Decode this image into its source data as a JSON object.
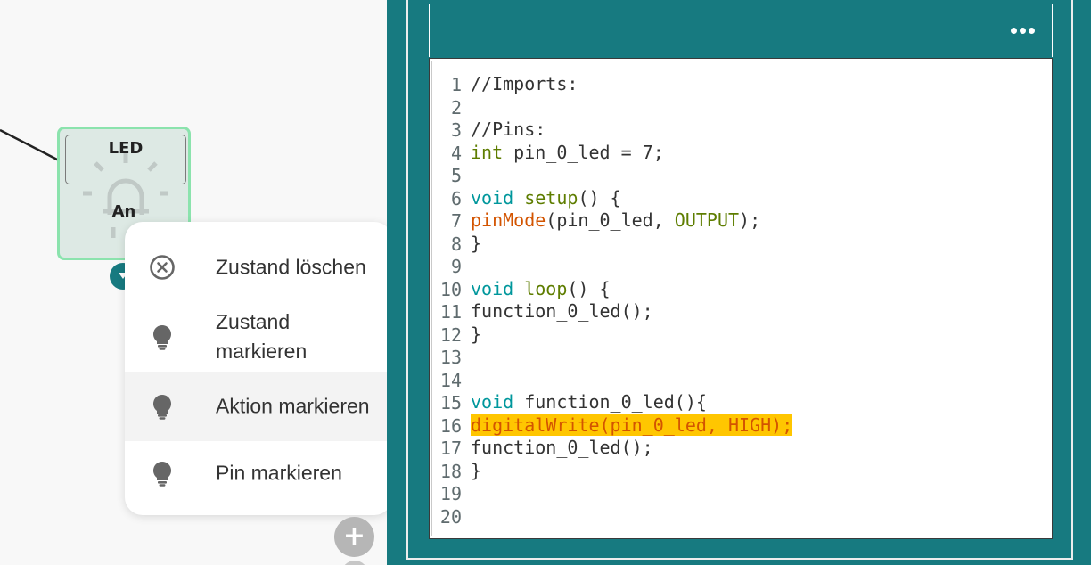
{
  "canvas": {
    "state_node": {
      "title": "LED",
      "value": "An",
      "icon": "lightbulb-icon"
    },
    "context_menu": {
      "items": [
        {
          "label": "Zustand löschen",
          "icon": "close-circle-icon"
        },
        {
          "label": "Zustand markieren",
          "icon": "lightbulb-icon"
        },
        {
          "label": "Aktion markieren",
          "icon": "lightbulb-icon",
          "hovered": true
        },
        {
          "label": "Pin markieren",
          "icon": "lightbulb-icon"
        }
      ]
    },
    "add_button": {
      "label": "+",
      "icon": "plus-icon"
    }
  },
  "editor": {
    "menu_icon": "more-horizontal-icon",
    "colors": {
      "frame": "#177a80",
      "keyword": "#00979c",
      "function": "#5e7d00",
      "call": "#d35400",
      "highlight": "#ffc600"
    },
    "line_numbers": [
      "1",
      "2",
      "3",
      "4",
      "5",
      "6",
      "7",
      "8",
      "9",
      "10",
      "11",
      "12",
      "13",
      "14",
      "15",
      "16",
      "17",
      "18",
      "19",
      "20"
    ],
    "lines": [
      {
        "num": "1",
        "tokens": [
          {
            "t": "//Imports:",
            "c": ""
          }
        ]
      },
      {
        "num": "2",
        "tokens": []
      },
      {
        "num": "3",
        "tokens": [
          {
            "t": "//Pins:",
            "c": ""
          }
        ]
      },
      {
        "num": "4",
        "tokens": [
          {
            "t": "int",
            "c": "fn"
          },
          {
            "t": " pin_0_led = 7;",
            "c": ""
          }
        ]
      },
      {
        "num": "5",
        "tokens": []
      },
      {
        "num": "6",
        "tokens": [
          {
            "t": "void",
            "c": "kw"
          },
          {
            "t": " ",
            "c": ""
          },
          {
            "t": "setup",
            "c": "fn"
          },
          {
            "t": "() {",
            "c": ""
          }
        ]
      },
      {
        "num": "7",
        "tokens": [
          {
            "t": "pinMode",
            "c": "call"
          },
          {
            "t": "(pin_0_led, ",
            "c": ""
          },
          {
            "t": "OUTPUT",
            "c": "const"
          },
          {
            "t": ");",
            "c": ""
          }
        ]
      },
      {
        "num": "8",
        "tokens": [
          {
            "t": "}",
            "c": ""
          }
        ]
      },
      {
        "num": "9",
        "tokens": []
      },
      {
        "num": "10",
        "tokens": [
          {
            "t": "void",
            "c": "kw"
          },
          {
            "t": " ",
            "c": ""
          },
          {
            "t": "loop",
            "c": "fn"
          },
          {
            "t": "() {",
            "c": ""
          }
        ]
      },
      {
        "num": "11",
        "tokens": [
          {
            "t": "function_0_led();",
            "c": ""
          }
        ]
      },
      {
        "num": "12",
        "tokens": [
          {
            "t": "}",
            "c": ""
          }
        ]
      },
      {
        "num": "13",
        "tokens": []
      },
      {
        "num": "14",
        "tokens": []
      },
      {
        "num": "15",
        "tokens": [
          {
            "t": "void",
            "c": "kw"
          },
          {
            "t": " function_0_led(){",
            "c": ""
          }
        ]
      },
      {
        "num": "16",
        "tokens": [
          {
            "t": "digitalWrite(pin_0_led, HIGH);",
            "c": "call hl"
          }
        ]
      },
      {
        "num": "17",
        "tokens": [
          {
            "t": "function_0_led();",
            "c": ""
          }
        ]
      },
      {
        "num": "18",
        "tokens": [
          {
            "t": "}",
            "c": ""
          }
        ]
      },
      {
        "num": "19",
        "tokens": []
      },
      {
        "num": "20",
        "tokens": []
      }
    ]
  }
}
